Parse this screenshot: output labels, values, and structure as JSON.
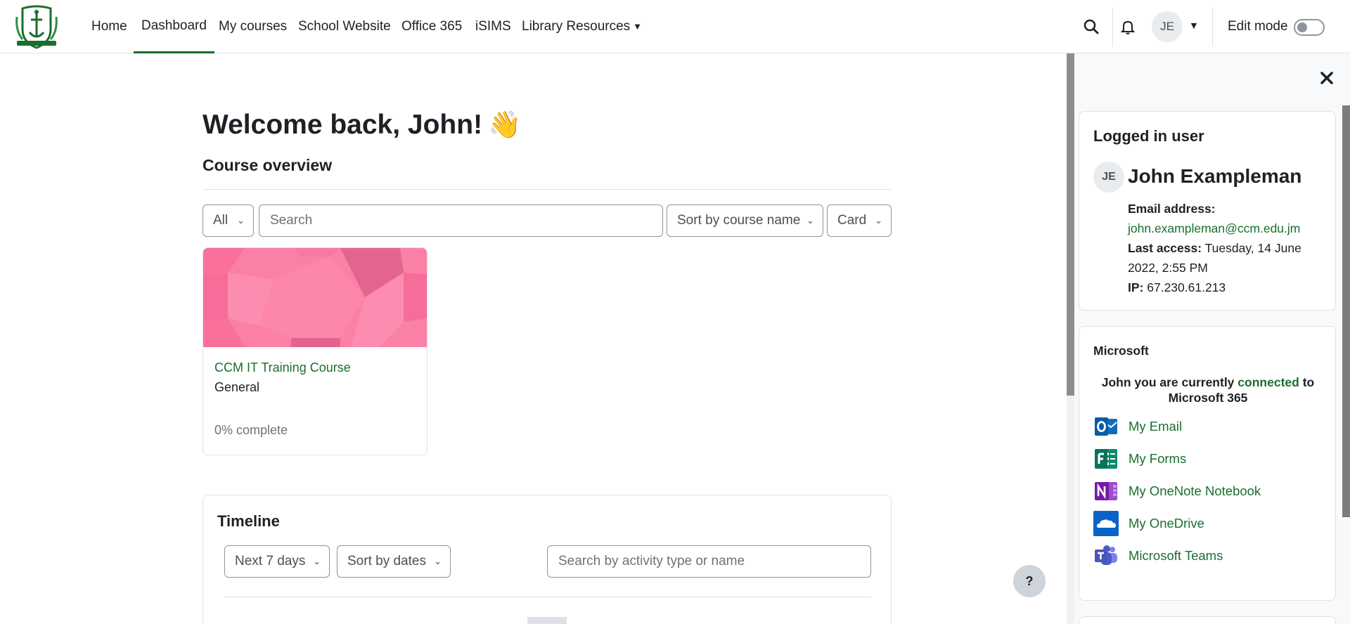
{
  "nav": {
    "items": [
      "Home",
      "Dashboard",
      "My courses",
      "School Website",
      "Office 365",
      "iSIMS",
      "Library Resources"
    ],
    "user_initials": "JE",
    "edit_mode_label": "Edit mode"
  },
  "main": {
    "welcome": "Welcome back, John!",
    "wave": "👋",
    "course_overview": {
      "title": "Course overview",
      "filter": "All",
      "search_placeholder": "Search",
      "sort": "Sort by course name",
      "view": "Card"
    },
    "course_card": {
      "name": "CCM IT Training Course",
      "category": "General",
      "progress": "0% complete",
      "progress_value": 0
    },
    "timeline": {
      "title": "Timeline",
      "range": "Next 7 days",
      "sort": "Sort by dates",
      "search_placeholder": "Search by activity type or name"
    },
    "help_label": "?"
  },
  "drawer": {
    "logged_in": {
      "title": "Logged in user",
      "initials": "JE",
      "full_name": "John Exampleman",
      "email_label": "Email address:",
      "email": "john.exampleman@ccm.edu.jm",
      "last_access_label": "Last access:",
      "last_access_line1": "Tuesday, 14 June",
      "last_access_line2": "2022, 2:55 PM",
      "ip_label": "IP:",
      "ip": "67.230.61.213"
    },
    "microsoft": {
      "title": "Microsoft",
      "status_prefix": "John you are currently",
      "status_word": "connected",
      "status_suffix": "to",
      "status_line2": "Microsoft 365",
      "links": [
        "My Email",
        "My Forms",
        "My OneNote Notebook",
        "My OneDrive",
        "Microsoft Teams"
      ]
    }
  },
  "colors": {
    "brand_green": "#1a6e2e",
    "card_pink": "#fb80a6",
    "text": "#1d2125"
  }
}
